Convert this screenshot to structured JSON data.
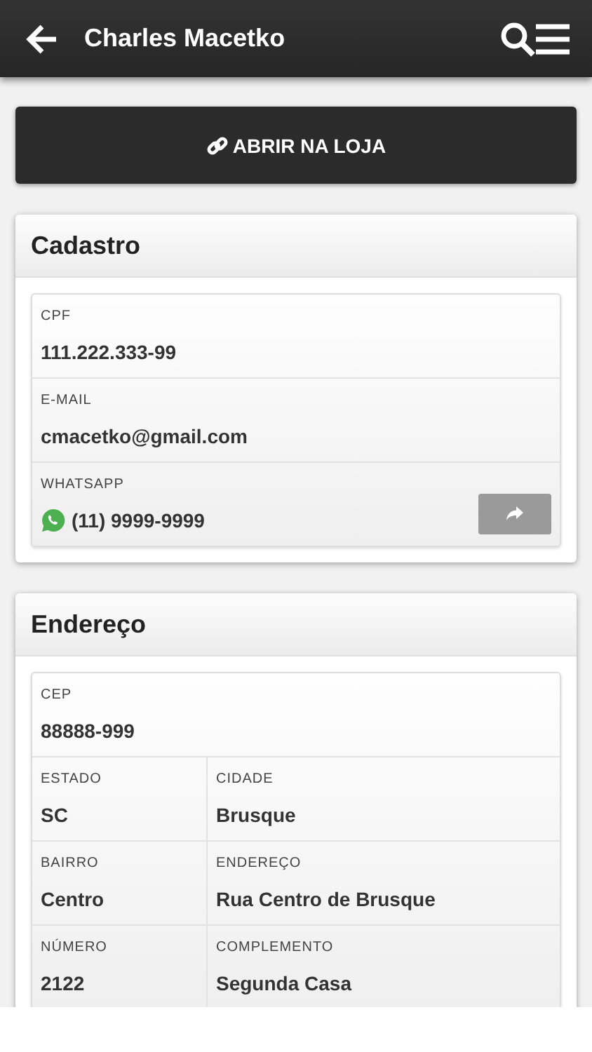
{
  "app_bar": {
    "title": "Charles Macetko"
  },
  "store_button": {
    "label": "ABRIR NA LOJA"
  },
  "sections": [
    {
      "title": "Cadastro",
      "rows": [
        {
          "cells": [
            {
              "label": "CPF",
              "value": "111.222.333-99",
              "kind": "text"
            }
          ]
        },
        {
          "cells": [
            {
              "label": "E-MAIL",
              "value": "cmacetko@gmail.com",
              "kind": "text"
            }
          ]
        },
        {
          "cells": [
            {
              "label": "WHATSAPP",
              "value": "(11) 9999-9999",
              "kind": "whatsapp"
            }
          ]
        }
      ]
    },
    {
      "title": "Endereço",
      "rows": [
        {
          "cells": [
            {
              "label": "CEP",
              "value": "88888-999",
              "kind": "text"
            }
          ]
        },
        {
          "cells": [
            {
              "label": "ESTADO",
              "value": "SC",
              "kind": "text"
            },
            {
              "label": "CIDADE",
              "value": "Brusque",
              "kind": "text"
            }
          ]
        },
        {
          "cells": [
            {
              "label": "BAIRRO",
              "value": "Centro",
              "kind": "text"
            },
            {
              "label": "ENDEREÇO",
              "value": "Rua Centro de Brusque",
              "kind": "text"
            }
          ]
        },
        {
          "cells": [
            {
              "label": "NÚMERO",
              "value": "2122",
              "kind": "text"
            },
            {
              "label": "COMPLEMENTO",
              "value": "Segunda Casa",
              "kind": "text"
            }
          ]
        }
      ]
    }
  ]
}
